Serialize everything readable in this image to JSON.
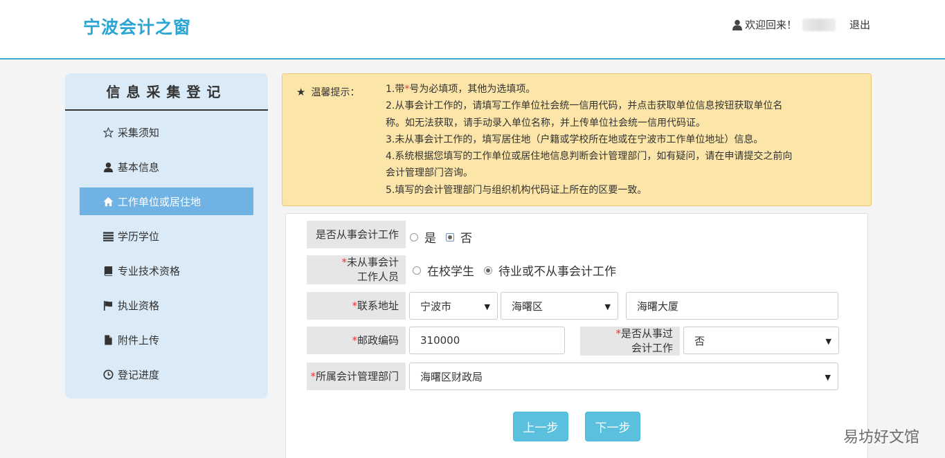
{
  "header": {
    "logo": "宁波会计之窗",
    "welcome": "欢迎回来！",
    "logout": "退出"
  },
  "sidebar": {
    "title": "信息采集登记",
    "items": [
      {
        "label": "采集须知",
        "icon": "star-outline-icon"
      },
      {
        "label": "基本信息",
        "icon": "user-icon"
      },
      {
        "label": "工作单位或居住地",
        "icon": "home-icon",
        "active": true
      },
      {
        "label": "学历学位",
        "icon": "list-icon"
      },
      {
        "label": "专业技术资格",
        "icon": "book-icon"
      },
      {
        "label": "执业资格",
        "icon": "flag-icon"
      },
      {
        "label": "附件上传",
        "icon": "file-icon"
      },
      {
        "label": "登记进度",
        "icon": "clock-icon"
      }
    ]
  },
  "notice": {
    "label": "温馨提示：",
    "line1_pre": "1.带",
    "line1_star": "*",
    "line1_post": "号为必填项，其他为选填项。",
    "line2a": "2.从事会计工作的，请填写工作单位社会统一信用代码，并点击获取单位信息按钮获取单位名",
    "line2b": "称。如无法获取，请手动录入单位名称，并上传单位社会统一信用代码证。",
    "line3": "3.未从事会计工作的，填写居住地（户籍或学校所在地或在宁波市工作单位地址）信息。",
    "line4a": "4.系统根据您填写的工作单位或居住地信息判断会计管理部门，如有疑问，请在申请提交之前向",
    "line4b": "会计管理部门咨询。",
    "line5": "5.填写的会计管理部门与组织机构代码证上所在的区要一致。"
  },
  "form": {
    "q1_label": "是否从事会计工作",
    "q1_yes": "是",
    "q1_no": "否",
    "q2_label_a": "未从事会计",
    "q2_label_b": "工作人员",
    "q2_opt1": "在校学生",
    "q2_opt2": "待业或不从事会计工作",
    "addr_label": "联系地址",
    "addr_city": "宁波市",
    "addr_district": "海曙区",
    "addr_detail": "海曙大厦",
    "zip_label": "邮政编码",
    "zip_value": "310000",
    "past_label_a": "是否从事过",
    "past_label_b": "会计工作",
    "past_value": "否",
    "dept_label": "所属会计管理部门",
    "dept_value": "海曙区财政局",
    "required_mark": "*",
    "prev": "上一步",
    "next": "下一步"
  },
  "watermark": "易坊好文馆",
  "colors": {
    "accent": "#2aa5d4",
    "active_item": "#6eb3e4",
    "notice_bg": "#fce5a8",
    "button": "#5bc0de"
  }
}
